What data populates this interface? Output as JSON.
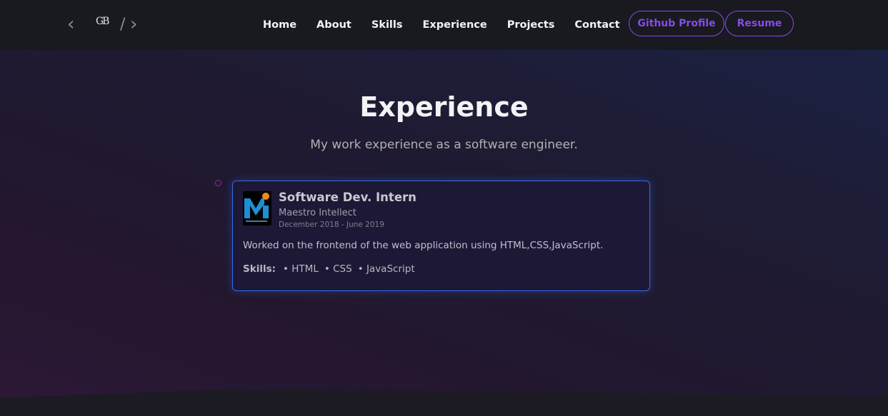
{
  "navbar": {
    "logo": {
      "initials": "GB",
      "slash": "/"
    },
    "links": [
      "Home",
      "About",
      "Skills",
      "Experience",
      "Projects",
      "Contact"
    ],
    "buttons": {
      "github": "Github Profile",
      "resume": "Resume"
    },
    "accent_color": "#854ce6"
  },
  "section": {
    "title": "Experience",
    "subtitle": "My work experience as a software engineer."
  },
  "experience": [
    {
      "role": "Software Dev. Intern",
      "company": "Maestro Intellect",
      "date": "December 2018 - June 2019",
      "description": "Worked on the frontend of the web application using HTML,CSS,JavaScript.",
      "skills_label": "Skills:",
      "skills": [
        "• HTML",
        "• CSS",
        "• JavaScript"
      ],
      "logo_icon": "maestro-intellect-logo"
    }
  ],
  "colors": {
    "card_border": "#306ee8",
    "timeline_dot": "#8c2e9a",
    "background": "#1c1b23"
  }
}
